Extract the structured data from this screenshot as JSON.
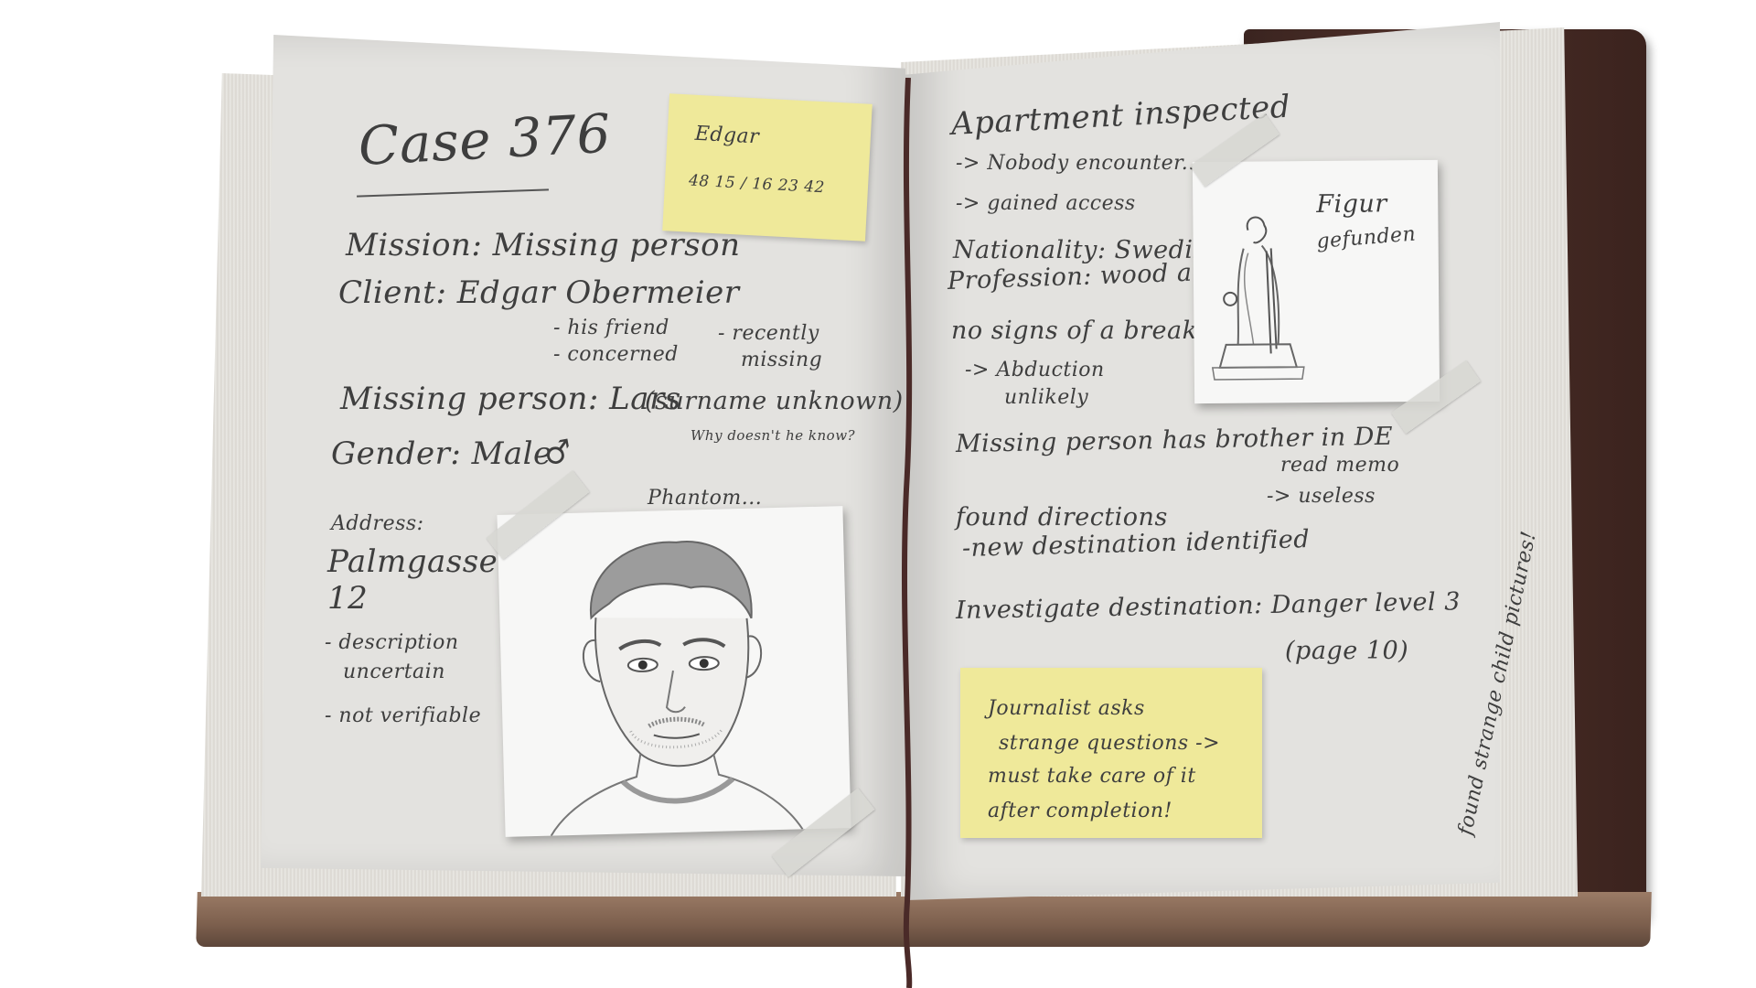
{
  "left_page": {
    "case_title": "Case 376",
    "mission": "Mission: Missing person",
    "client": "Client: Edgar Obermeier",
    "client_notes": [
      "- his friend",
      "- concerned"
    ],
    "client_notes_2": [
      "- recently",
      "missing"
    ],
    "missing_person": "Missing person: Lars",
    "surname_note": "(surname unknown)",
    "surname_aside": "Why doesn't he know?",
    "gender": "Gender: Male",
    "gender_symbol": "♂",
    "address_label": "Address:",
    "address_lines": [
      "Palmgasse",
      "12"
    ],
    "address_notes": [
      "- description",
      "uncertain",
      "- not verifiable"
    ],
    "phantom_label": "Phantom..."
  },
  "sticky_edgar": {
    "name": "Edgar",
    "number": "48 15 / 16 23 42"
  },
  "portrait": {
    "icon": "portrait-sketch-icon"
  },
  "right_page": {
    "lines": [
      "Apartment inspected",
      "-> Nobody encounter...",
      "-> gained access",
      "Nationality: Swedish",
      "Profession: wood artist",
      "no signs of a break-in",
      "-> Abduction",
      "unlikely",
      "Missing person has brother in DE",
      "read memo",
      "-> useless",
      "found directions",
      "-new destination identified",
      "Investigate destination: Danger level 3",
      "(page 10)"
    ],
    "vertical_note": "found strange child pictures!"
  },
  "figure_photo": {
    "caption_lines": [
      "Figur",
      "gefunden"
    ],
    "icon": "statue-sketch-icon"
  },
  "sticky_journalist": {
    "lines": [
      "Journalist asks",
      "strange questions ->",
      "must take care of it",
      "after completion!"
    ]
  },
  "colors": {
    "page": "#e3e2df",
    "sticky": "#efe99a",
    "ink": "#3e3e3e",
    "cover": "#3a2420",
    "ribbon": "#4a2a28"
  }
}
